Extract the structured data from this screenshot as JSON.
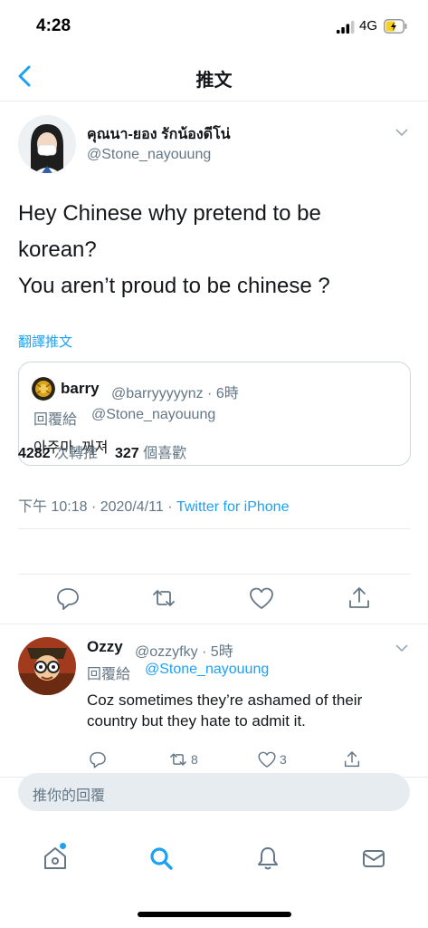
{
  "status_bar": {
    "time": "4:28",
    "network": "4G"
  },
  "nav": {
    "title": "推文"
  },
  "tweet": {
    "author_name": "คุณนา-ยอง รักน้องดีโน่",
    "author_handle": "@Stone_nayouung",
    "text_lines": [
      "Hey Chinese why pretend to be",
      "korean?",
      "You aren’t proud to be chinese ?"
    ],
    "translate_label": "翻譯推文",
    "quote": {
      "name": "barry",
      "handle_time": "@barryyyyynz · 6時",
      "reply_label": "回覆給",
      "reply_handle": "@Stone_nayouung",
      "text": "아주마. 꺼져"
    },
    "time": "下午 10:18",
    "date": "2020/4/11",
    "source": "Twitter for iPhone",
    "retweets_count": "4282",
    "retweets_label": "次轉推",
    "likes_count": "327",
    "likes_label": "個喜歡"
  },
  "reply": {
    "name": "Ozzy",
    "handle_time": "@ozzyfky · 5時",
    "reply_label": "回覆給",
    "reply_handle": "@Stone_nayouung",
    "text": "Coz sometimes they’re ashamed of their country but they hate to admit it.",
    "retweet_count": "8",
    "like_count": "3"
  },
  "composer": {
    "placeholder": "推你的回覆"
  },
  "colors": {
    "accent": "#1da1f2",
    "secondary_text": "#657786",
    "divider": "#e6ecf0"
  },
  "icons": [
    "signal-icon",
    "battery-icon",
    "back-icon",
    "chevron-down-icon",
    "reply-icon",
    "retweet-icon",
    "like-icon",
    "share-icon",
    "home-icon",
    "search-icon",
    "notifications-icon",
    "messages-icon"
  ]
}
